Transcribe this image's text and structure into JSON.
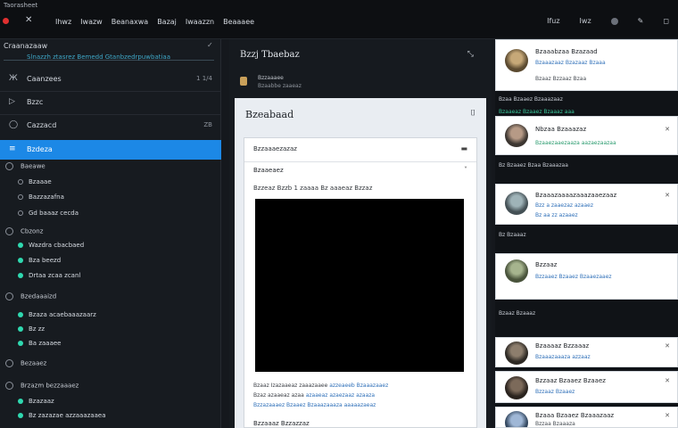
{
  "window": {
    "title": "Taorasheet"
  },
  "topnav": [
    "Ihwz",
    "Iwazw",
    "Beanaxwa",
    "Bazaj",
    "Iwaazzn",
    "Beaaaee"
  ],
  "topright": {
    "item1": "Ifuz",
    "item2": "Iwz"
  },
  "sidebar": {
    "header": "Craanazaaw",
    "search_placeholder": "Slnazzh ztasrez Bemedd Gtanbzedrpuwbatiaa",
    "items": [
      {
        "icon": "Ж",
        "label": "Caanzees",
        "meta": "1 1/4"
      },
      {
        "icon": "▷",
        "label": "Bzzc",
        "meta": ""
      },
      {
        "icon": "◯",
        "label": "Cazzacd",
        "meta": "ZB"
      },
      {
        "icon": "≡",
        "label": "Bzdeza",
        "meta": ""
      }
    ],
    "sections": [
      {
        "label": "Baeawe",
        "subs": [
          "Bzaaae",
          "Bazzazafna",
          "Gd baaaz cecda"
        ]
      },
      {
        "label": "Cbzonz",
        "subs": [
          "Wazdra cbacbaed",
          "Bza beezd",
          "Drtaa zcaa zcanl"
        ]
      },
      {
        "label": "Bzedaaaizd",
        "subs": [
          "Bzaza acaebaaazaarz",
          "Bz zz",
          "Ba zaaaee"
        ]
      },
      {
        "label": "Bezaaez",
        "subs": []
      },
      {
        "label": "Brzazm bezzaaaez",
        "subs": [
          "Bzazaaz",
          "Bz zazazae azzaaazaaea"
        ]
      }
    ]
  },
  "middle": {
    "header": "Bzzj Tbaebaz",
    "sub_title": "Bzzaaaee",
    "sub_meta": "Bzaabbe zaaeaz",
    "doc_title": "Bzeabaad",
    "card": {
      "row1": "Bzzaaaezazaz",
      "row2": "Bzaaeaez",
      "row3": "Bzzeaz Bzzb 1 zaaaa Bz aaaeaz Bzzaz",
      "body1a": "Bzaaz Izazaaeaz zaaazaaee",
      "body1b": "azzeaeeb Bzaaazaaez",
      "body2a": "Bzaz azaaeaz azaa",
      "body2b": "azaaeaz azaezaaz azaaza",
      "body3": "Bzzazaaaez Bzaaez Bzaaazaaaza aaaaazaeaz",
      "body4": "Bzzaaaz Bzzazzaz"
    }
  },
  "right": {
    "cards": [
      {
        "name": "Bzaaabzaa Bzazaad",
        "desc1": "Bzaaazaaz Bzazaaz Bzaaa",
        "desc2": "Bzaaz Bzzaaz Bzaa"
      },
      {
        "name": "Nbzaa Bzaaazaz",
        "desc1": "Bzaaezaaezaaza aazaezaazaa"
      },
      {
        "name": "Bzaaazaaaazaaazaaezaaz",
        "desc1": "Bzz a zaaezaz azaaez",
        "desc2": "Bz aa zz azaaez"
      },
      {
        "name": "Bzzaaz",
        "desc1": "Bzzaaez Bzaaez Bzaaezaaez"
      },
      {
        "name": "Bzaaaaz Bzzaaaz",
        "desc1": "Bzaaazaaaza azzaaz"
      },
      {
        "name": "Bzzaaz Bzaaez Bzaaez",
        "desc1": "Bzzaaz Bzaaez"
      },
      {
        "name": "Bzaaa Bzaaez Bzaaazaaz",
        "desc1": "Bzzaa Bzaaaza"
      }
    ],
    "labels": [
      "Bzaa Bzaaez Bzaaazaaz",
      "Bzaaeaz Bzaaez Bzaaaz aaa",
      "Bz Bzaaez Bzaa Bzaaazaa",
      "Bz Bzaaaz",
      "Bzaaz Bzaaaz"
    ]
  },
  "colors": {
    "accent": "#1c88e6",
    "status": "#2fd9b0",
    "link": "#2e6fb8",
    "danger": "#e03030"
  }
}
